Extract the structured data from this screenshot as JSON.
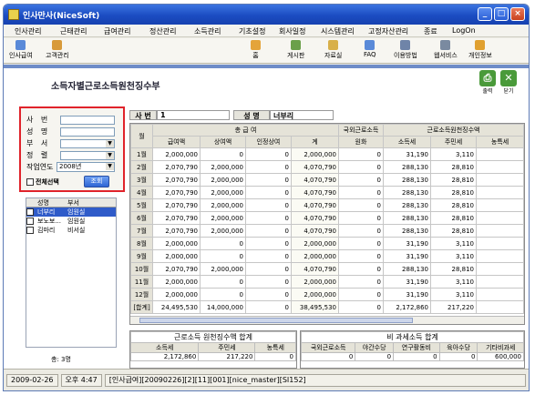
{
  "window": {
    "title": "인사만사(NiceSoft)"
  },
  "menu": [
    "인사관리",
    "근태관리",
    "급여관리",
    "정산관리",
    "소득관리",
    "기초설정",
    "회사일정",
    "시스템관리",
    "고정자산관리",
    "종료",
    "LogOn"
  ],
  "toolbar_left": [
    "인사급여",
    "고객관리"
  ],
  "toolbar_right": [
    "홈",
    "게시판",
    "자료실",
    "FAQ",
    "이용방법",
    "웹서비스",
    "개인정보"
  ],
  "page": {
    "title": "소득자별근로소득원천징수부",
    "print_label": "출력",
    "close_label": "닫기"
  },
  "filter": {
    "labels": [
      "사 번",
      "성 명",
      "부 서",
      "정 렬",
      "작업연도"
    ],
    "year_value": "2008년",
    "select_all_label": "전체선택",
    "lookup_label": "조회"
  },
  "employee_list": {
    "headers": [
      "성명",
      "부서"
    ],
    "rows": [
      {
        "name": "너부리",
        "dept": "임원실"
      },
      {
        "name": "보노보...",
        "dept": "임원실"
      },
      {
        "name": "김마리",
        "dept": "비서실"
      }
    ],
    "total": "총: 3명"
  },
  "record": {
    "emp_no_label": "사 번",
    "emp_no": "1",
    "name_label": "성 명",
    "name": "너부리"
  },
  "grid": {
    "month_header": "월",
    "group_headers": [
      "총 급 여",
      "국외근로소득",
      "근로소득원천징수액"
    ],
    "headers": [
      "급여액",
      "상여액",
      "인정상여",
      "계",
      "원화",
      "소득세",
      "주민세",
      "농특세"
    ],
    "rows": [
      [
        "1월",
        "2,000,000",
        "0",
        "0",
        "2,000,000",
        "0",
        "31,190",
        "3,110",
        ""
      ],
      [
        "2월",
        "2,070,790",
        "2,000,000",
        "0",
        "4,070,790",
        "0",
        "288,130",
        "28,810",
        ""
      ],
      [
        "3월",
        "2,070,790",
        "2,000,000",
        "0",
        "4,070,790",
        "0",
        "288,130",
        "28,810",
        ""
      ],
      [
        "4월",
        "2,070,790",
        "2,000,000",
        "0",
        "4,070,790",
        "0",
        "288,130",
        "28,810",
        ""
      ],
      [
        "5월",
        "2,070,790",
        "2,000,000",
        "0",
        "4,070,790",
        "0",
        "288,130",
        "28,810",
        ""
      ],
      [
        "6월",
        "2,070,790",
        "2,000,000",
        "0",
        "4,070,790",
        "0",
        "288,130",
        "28,810",
        ""
      ],
      [
        "7월",
        "2,070,790",
        "2,000,000",
        "0",
        "4,070,790",
        "0",
        "288,130",
        "28,810",
        ""
      ],
      [
        "8월",
        "2,000,000",
        "0",
        "0",
        "2,000,000",
        "0",
        "31,190",
        "3,110",
        ""
      ],
      [
        "9월",
        "2,000,000",
        "0",
        "0",
        "2,000,000",
        "0",
        "31,190",
        "3,110",
        ""
      ],
      [
        "10월",
        "2,070,790",
        "2,000,000",
        "0",
        "4,070,790",
        "0",
        "288,130",
        "28,810",
        ""
      ],
      [
        "11월",
        "2,000,000",
        "0",
        "0",
        "2,000,000",
        "0",
        "31,190",
        "3,110",
        ""
      ],
      [
        "12월",
        "2,000,000",
        "0",
        "0",
        "2,000,000",
        "0",
        "31,190",
        "3,110",
        ""
      ],
      [
        "[합계]",
        "24,495,530",
        "14,000,000",
        "0",
        "38,495,530",
        "0",
        "2,172,860",
        "217,220",
        ""
      ]
    ]
  },
  "summary_left": {
    "title": "근로소득 원천징수액 합계",
    "headers": [
      "소득세",
      "주민세",
      "농특세"
    ],
    "values": [
      "2,172,860",
      "217,220",
      "0"
    ]
  },
  "summary_right": {
    "title": "비 과세소득 합계",
    "headers": [
      "국외근로소득",
      "야간수당",
      "연구활동비",
      "육아수당",
      "기타비과세"
    ],
    "values": [
      "0",
      "0",
      "0",
      "0",
      "600,000"
    ]
  },
  "status": [
    "2009-02-26",
    "오후 4:47",
    "[인사급여][20090226][2][11][001][nice_master][SI152]"
  ]
}
